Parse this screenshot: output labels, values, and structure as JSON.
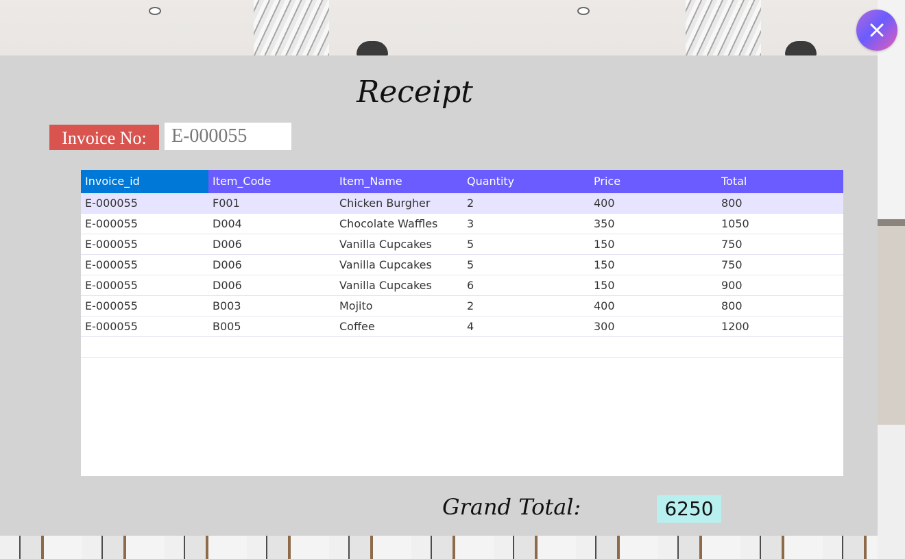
{
  "receipt": {
    "title": "Receipt",
    "invoice_label": "Invoice No:",
    "invoice_value": "E-000055",
    "grand_total_label": "Grand Total:",
    "grand_total_value": "6250"
  },
  "table": {
    "columns": [
      "Invoice_id",
      "Item_Code",
      "Item_Name",
      "Quantity",
      "Price",
      "Total"
    ],
    "rows": [
      [
        "E-000055",
        "F001",
        "Chicken Burgher",
        "2",
        "400",
        "800"
      ],
      [
        "E-000055",
        "D004",
        "Chocolate Waffles",
        "3",
        "350",
        "1050"
      ],
      [
        "E-000055",
        "D006",
        "Vanilla Cupcakes",
        "5",
        "150",
        "750"
      ],
      [
        "E-000055",
        "D006",
        "Vanilla Cupcakes",
        "5",
        "150",
        "750"
      ],
      [
        "E-000055",
        "D006",
        "Vanilla Cupcakes",
        "6",
        "150",
        "900"
      ],
      [
        "E-000055",
        "B003",
        "Mojito",
        "2",
        "400",
        "800"
      ],
      [
        "E-000055",
        "B005",
        "Coffee",
        "4",
        "300",
        "1200"
      ]
    ]
  },
  "icons": {
    "close": "close-icon"
  },
  "colors": {
    "header_bg": "#6a5cff",
    "active_header_bg": "#0078d7",
    "invoice_label_bg": "#d9534f",
    "grand_total_bg": "#b8f0f0",
    "panel_bg": "#d3d3d3"
  }
}
